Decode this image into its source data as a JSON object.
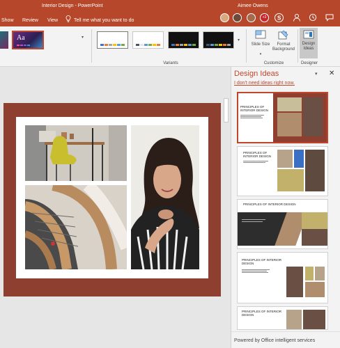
{
  "titlebar": {
    "tabs": [
      "Show",
      "Review",
      "View"
    ],
    "doc_title": "Interior Design - PowerPoint",
    "tell_me": "Tell me what you want to do",
    "user_name": "Aimee Owens",
    "coauthor_count": "+3",
    "icons": [
      "lightbulb-icon",
      "share-icon",
      "person-icon",
      "history-icon",
      "chat-icon"
    ]
  },
  "ribbon": {
    "theme_label": "Aa",
    "variants_group": "Variants",
    "customize_group": "Customize",
    "designer_group": "Designer",
    "slide_size": "Slide Size",
    "slide_size_caret": "▾",
    "format_background": "Format Background",
    "design_ideas": "Design Ideas",
    "variant_colors": [
      [
        "#4472c4",
        "#ed7d31",
        "#a5a5a5",
        "#ffc000",
        "#5b9bd5",
        "#70ad47"
      ],
      [
        "#44546a",
        "#e7e6e6",
        "#5b9bd5",
        "#70ad47",
        "#ffc000",
        "#ed7d31"
      ],
      [
        "#4472c4",
        "#ed7d31",
        "#a5a5a5",
        "#ffc000",
        "#5b9bd5",
        "#70ad47"
      ],
      [
        "#44546a",
        "#5b9bd5",
        "#70ad47",
        "#ffc000",
        "#ed7d31",
        "#a5a5a5"
      ]
    ]
  },
  "pane": {
    "title": "Design Ideas",
    "dismiss_link": "I don't need ideas right now.",
    "footer": "Powered by Office intelligent services",
    "thumb_titles": [
      "PRINCIPLES OF INTERIOR DESIGN",
      "PRINCIPLES OF INTERIOR DESIGN",
      "PRINCIPLES OF INTERIOR DESIGN",
      "PRINCIPLES OF INTERIOR DESIGN",
      "PRINCIPLES OF INTERIOR DESIGN"
    ]
  },
  "colors": {
    "accent": "#b7472a",
    "slide_frame": "#8f3f2f",
    "link": "#c0462b"
  }
}
